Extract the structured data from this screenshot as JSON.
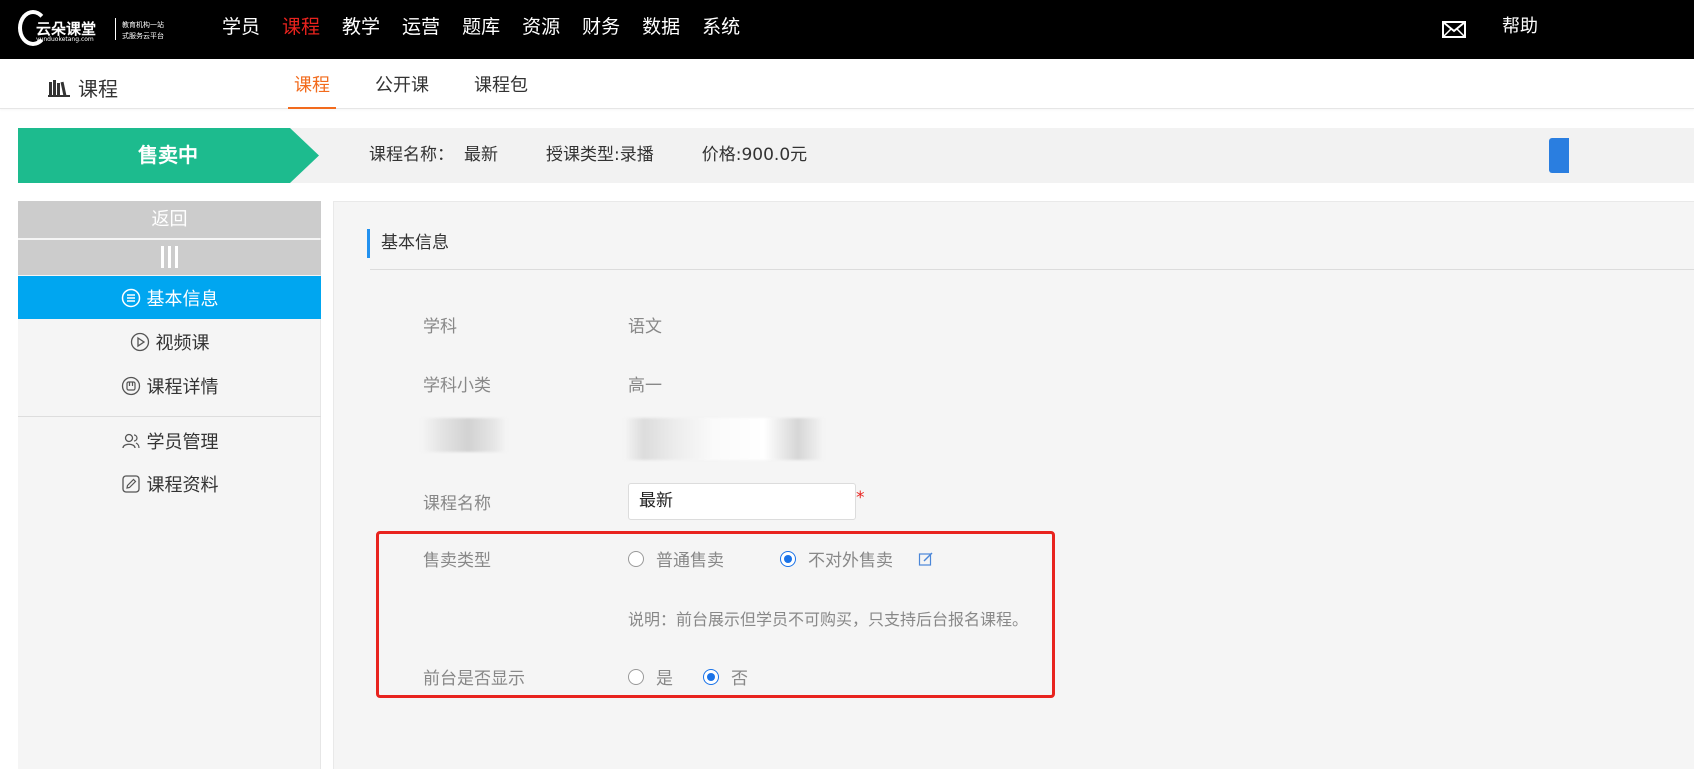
{
  "logo": {
    "brand": "云朵课堂",
    "brand_sub": "yunduoketang.com",
    "slogan_line1": "教育机构一站",
    "slogan_line2": "式服务云平台"
  },
  "main_nav": [
    {
      "label": "学员",
      "active": false
    },
    {
      "label": "课程",
      "active": true
    },
    {
      "label": "教学",
      "active": false
    },
    {
      "label": "运营",
      "active": false
    },
    {
      "label": "题库",
      "active": false
    },
    {
      "label": "资源",
      "active": false
    },
    {
      "label": "财务",
      "active": false
    },
    {
      "label": "数据",
      "active": false
    },
    {
      "label": "系统",
      "active": false
    }
  ],
  "header_right": {
    "mail_icon": "envelope-icon",
    "help_label": "帮助"
  },
  "subheader": {
    "title": "课程",
    "icon": "books-icon",
    "tabs": [
      {
        "label": "课程",
        "active": true
      },
      {
        "label": "公开课",
        "active": false
      },
      {
        "label": "课程包",
        "active": false
      }
    ]
  },
  "banner": {
    "status": "售卖中",
    "status_color": "#1dbb8e",
    "course_name_label": "课程名称：",
    "course_name": "最新",
    "teach_type_label": "授课类型:",
    "teach_type": "录播",
    "price_label": "价格:",
    "price": "900.0元"
  },
  "sidebar": {
    "back_label": "返回",
    "items": [
      {
        "label": "基本信息",
        "icon": "list-circle-icon",
        "active": true
      },
      {
        "label": "视频课",
        "icon": "play-circle-icon",
        "active": false
      },
      {
        "label": "课程详情",
        "icon": "detail-circle-icon",
        "active": false
      },
      {
        "label": "学员管理",
        "icon": "users-icon",
        "active": false
      },
      {
        "label": "课程资料",
        "icon": "pencil-doc-icon",
        "active": false
      }
    ]
  },
  "form": {
    "section_title": "基本信息",
    "subject_label": "学科",
    "subject_value": "语文",
    "subcategory_label": "学科小类",
    "subcategory_value": "高一",
    "course_name_label": "课程名称",
    "course_name_value": "最新",
    "required_mark": "*",
    "sale_type_label": "售卖类型",
    "sale_type_options": [
      "普通售卖",
      "不对外售卖"
    ],
    "sale_type_selected": "不对外售卖",
    "sale_note": "说明：前台展示但学员不可购买，只支持后台报名课程。",
    "front_display_label": "前台是否显示",
    "front_display_options": [
      "是",
      "否"
    ],
    "front_display_selected": "否"
  },
  "colors": {
    "accent_orange": "#f26b1d",
    "nav_active_red": "#e8231e",
    "sidebar_active": "#00a6f0",
    "radio_blue": "#1a73e8"
  }
}
